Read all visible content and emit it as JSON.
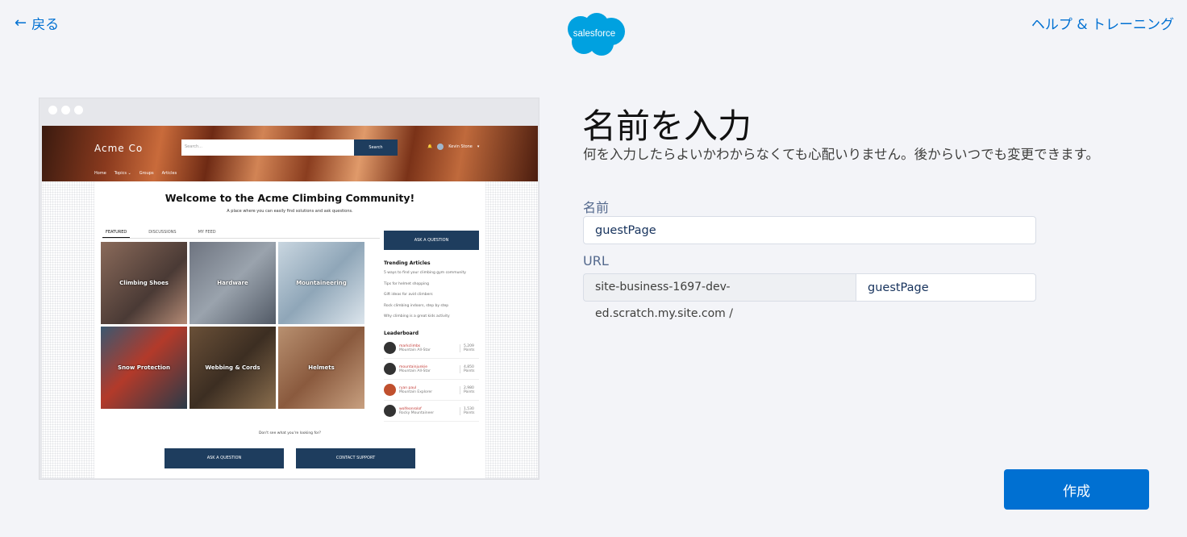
{
  "header": {
    "back_label": "戻る",
    "back_arrow": "←",
    "help_label": "ヘルプ & トレーニング",
    "logo_text": "salesforce",
    "logo_color": "#00a1e0"
  },
  "preview": {
    "brand": "Acme Co",
    "search_placeholder": "Search...",
    "search_button": "Search",
    "user_name": "Kevin Stone",
    "nav": [
      "Home",
      "Topics ⌄",
      "Groups",
      "Articles"
    ],
    "welcome_title": "Welcome to the Acme Climbing Community!",
    "welcome_subtitle": "A place where you can easily find solutions and ask questions.",
    "tabs": [
      "FEATURED",
      "DISCUSSIONS",
      "MY FEED"
    ],
    "tiles": [
      "Climbing Shoes",
      "Hardware",
      "Mountaineering",
      "Snow Protection",
      "Webbing & Cords",
      "Helmets"
    ],
    "ask_button": "ASK A QUESTION",
    "trending_heading": "Trending Articles",
    "trending": [
      "5 ways to find your climbing gym community",
      "Tips for helmet shopping",
      "Gift ideas for avid climbers",
      "Rock climbing indoors, step by step",
      "Why climbing is a great kids activity"
    ],
    "leaderboard_heading": "Leaderboard",
    "leaderboard": [
      {
        "name": "markclimbs",
        "rank": "Mountain All-Star",
        "points": "5,209 Points"
      },
      {
        "name": "mountainjunkie",
        "rank": "Mountain All-Star",
        "points": "4,850 Points"
      },
      {
        "name": "ryan paul",
        "rank": "Mountain Explorer",
        "points": "2,980 Points"
      },
      {
        "name": "wolfeonrolof",
        "rank": "Rocky Mountaineer",
        "points": "1,530 Points"
      }
    ],
    "dont_see": "Don't see what you're looking for?",
    "bottom_ask": "ASK A QUESTION",
    "bottom_contact": "CONTACT SUPPORT"
  },
  "form": {
    "title": "名前を入力",
    "subtitle": "何を入力したらよいかわからなくても心配いりません。後からいつでも変更できます。",
    "name_label": "名前",
    "name_value": "guestPage",
    "url_label": "URL",
    "url_prefix": "site-business-1697-dev-ed.scratch.my.site.com /",
    "url_value": "guestPage",
    "create_label": "作成"
  },
  "colors": {
    "accent": "#0070d2",
    "background": "#f3f4f8",
    "preview_button": "#1e3d5e"
  }
}
